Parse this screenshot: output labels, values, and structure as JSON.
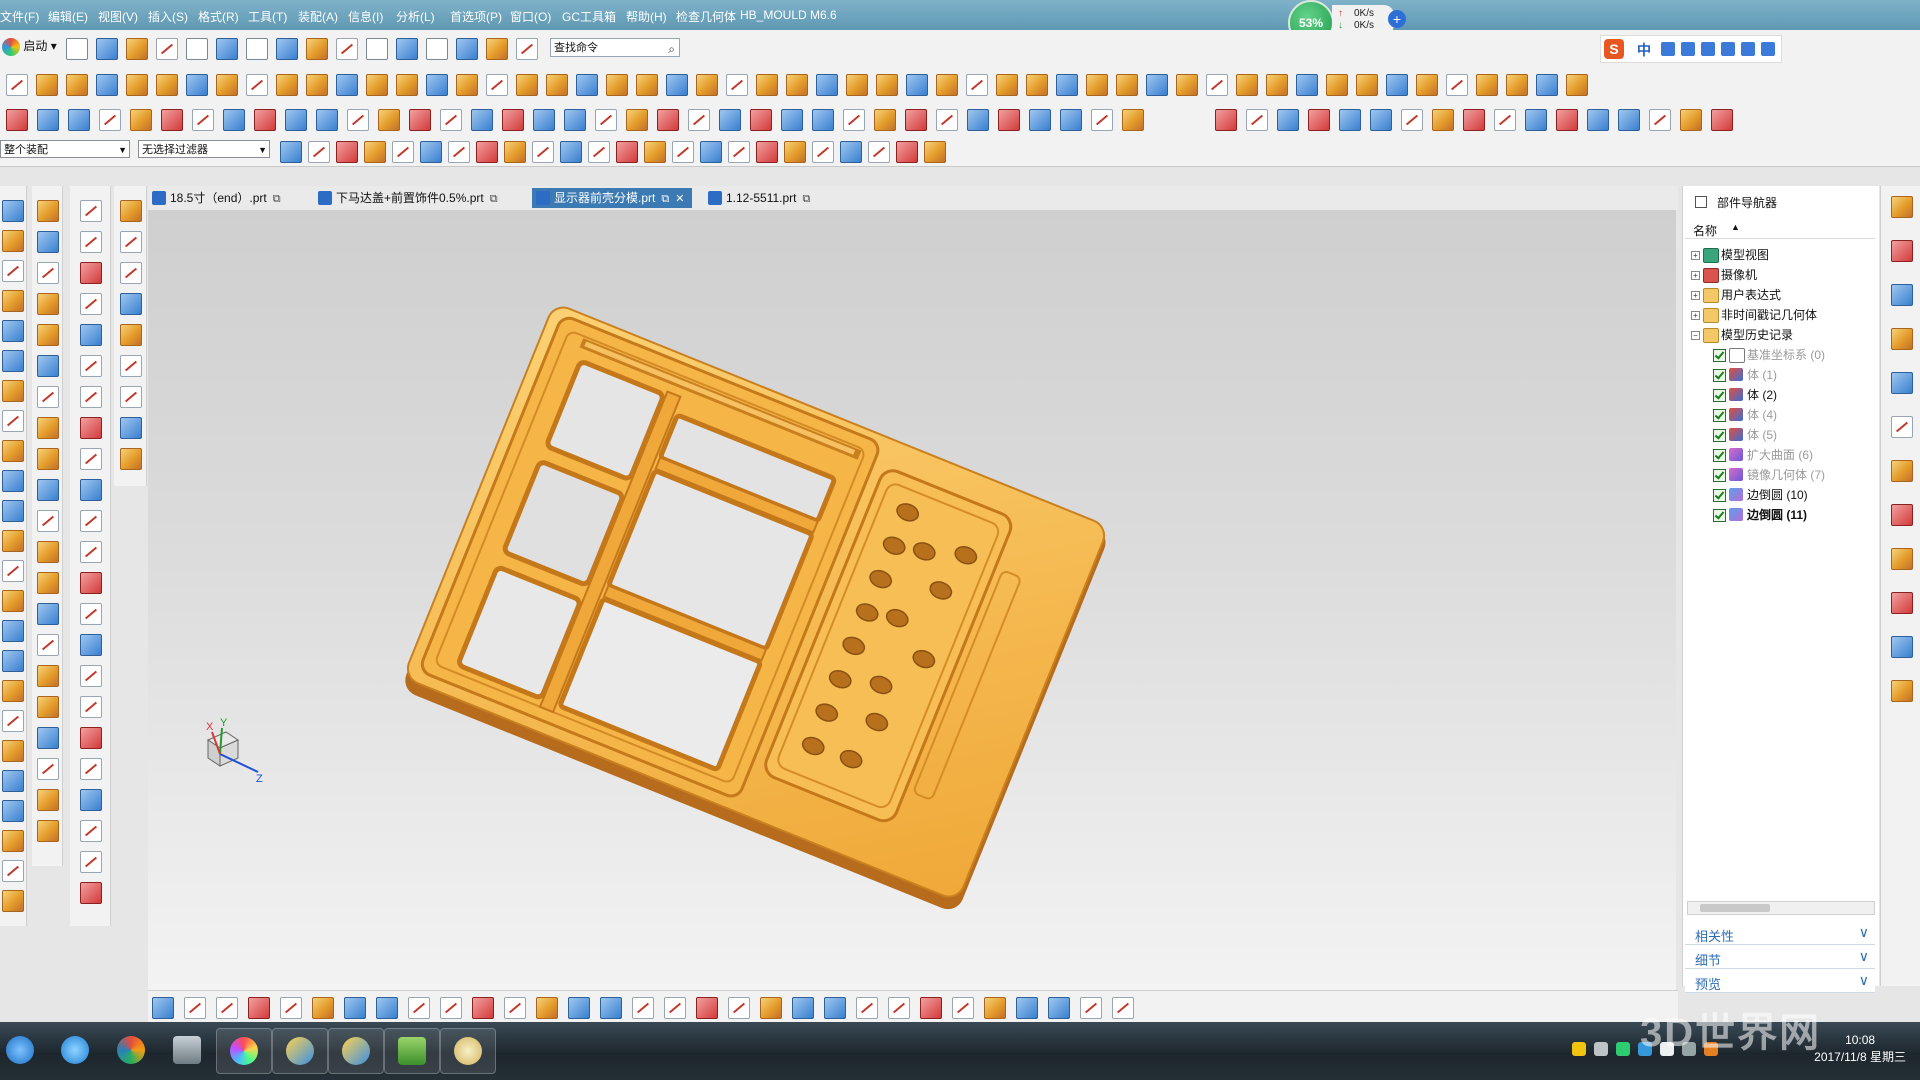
{
  "menu": [
    "文件(F)",
    "编辑(E)",
    "视图(V)",
    "插入(S)",
    "格式(R)",
    "工具(T)",
    "装配(A)",
    "信息(I)",
    "分析(L)",
    "首选项(P)",
    "窗口(O)",
    "GC工具箱",
    "帮助(H)",
    "检查几何体",
    "HB_MOULD M6.6"
  ],
  "net_widget": {
    "percent": "53%",
    "up": "0K/s",
    "down": "0K/s"
  },
  "toolbar": {
    "start_label": "启动",
    "search_value": "查找命令",
    "assembly_combo": "整个装配",
    "filter_combo": "无选择过滤器"
  },
  "ime": {
    "label": "中"
  },
  "tabs": [
    {
      "label": "18.5寸（end）.prt",
      "active": false
    },
    {
      "label": "下马达盖+前置饰件0.5%.prt",
      "active": false
    },
    {
      "label": "显示器前壳分模.prt",
      "active": true
    },
    {
      "label": "1.12-5511.prt",
      "active": false
    }
  ],
  "navigator": {
    "title": "部件导航器",
    "column_name": "名称",
    "tree": [
      {
        "label": "模型视图",
        "icon": "model-views-icon",
        "level": 0,
        "style": "normal"
      },
      {
        "label": "摄像机",
        "icon": "camera-icon",
        "level": 0,
        "style": "normal"
      },
      {
        "label": "用户表达式",
        "icon": "folder-icon",
        "level": 0,
        "style": "normal"
      },
      {
        "label": "非时间戳记几何体",
        "icon": "folder-icon",
        "level": 0,
        "style": "normal"
      },
      {
        "label": "模型历史记录",
        "icon": "folder-icon",
        "level": 0,
        "style": "normal"
      },
      {
        "label": "基准坐标系 (0)",
        "icon": "datum-csys-icon",
        "level": 1,
        "style": "dim"
      },
      {
        "label": "体 (1)",
        "icon": "body-icon",
        "level": 1,
        "style": "dim"
      },
      {
        "label": "体 (2)",
        "icon": "body-icon",
        "level": 1,
        "style": "normal"
      },
      {
        "label": "体 (4)",
        "icon": "body-icon",
        "level": 1,
        "style": "dim"
      },
      {
        "label": "体 (5)",
        "icon": "body-icon",
        "level": 1,
        "style": "dim"
      },
      {
        "label": "扩大曲面 (6)",
        "icon": "enlarge-surface-icon",
        "level": 1,
        "style": "dim"
      },
      {
        "label": "镜像几何体 (7)",
        "icon": "mirror-geometry-icon",
        "level": 1,
        "style": "dim"
      },
      {
        "label": "边倒圆 (10)",
        "icon": "edge-blend-icon",
        "level": 1,
        "style": "normal"
      },
      {
        "label": "边倒圆 (11)",
        "icon": "edge-blend-icon",
        "level": 1,
        "style": "bold"
      }
    ],
    "panels": [
      "相关性",
      "细节",
      "预览"
    ]
  },
  "triad": {
    "x": "X",
    "y": "Y",
    "z": "Z"
  },
  "taskbar": {
    "time": "10:08",
    "date": "2017/11/8 星期三"
  },
  "watermark": "3D世界网",
  "colors": {
    "part": "#f5b041",
    "menubar": "#5f98b3",
    "active_tab": "#3c7ab3"
  }
}
